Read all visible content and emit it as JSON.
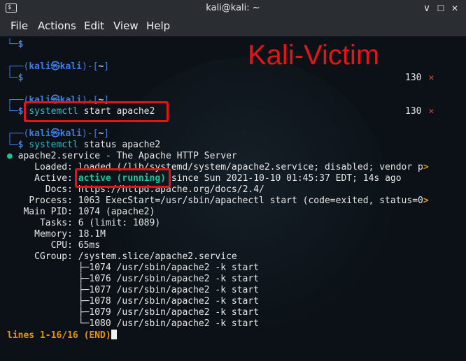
{
  "window": {
    "title": "kali@kali: ~",
    "min_symbol": "∨",
    "max_symbol": "☐",
    "close_symbol": "✕",
    "icon_text": "$_"
  },
  "menu": [
    "File",
    "Actions",
    "Edit",
    "View",
    "Help"
  ],
  "overlay_label": "Kali-Victim",
  "prompt": {
    "open": "┌──(",
    "user": "kali",
    "at": "㉿",
    "host": "kali",
    "mid": ")-[",
    "dir": "~",
    "close": "]",
    "dollar": "$",
    "corner": "└─"
  },
  "exit_codes": [
    "130",
    "130"
  ],
  "x_mark": "✕",
  "commands": {
    "cmd1": "systemctl start apache2",
    "cmd2": "systemctl status apache2",
    "cmd1_word": "systemctl",
    "cmd1_rest": " start apache2",
    "cmd2_word": "systemctl",
    "cmd2_rest": " status apache2"
  },
  "status": {
    "dot": "●",
    "header": "apache2.service - The Apache HTTP Server",
    "loaded_label": "Loaded:",
    "loaded_value": "loaded (/lib/systemd/system/apache2.service; disabled; vendor p",
    "active_label": "Active:",
    "active_state": "active (running)",
    "active_since": " since Sun 2021-10-10 01:45:37 EDT; 14s ago",
    "docs_label": "Docs:",
    "docs_value": "https://httpd.apache.org/docs/2.4/",
    "process_label": "Process:",
    "process_value": "1063 ExecStart=/usr/sbin/apachectl start (code=exited, status=0",
    "mainpid_label": "Main PID:",
    "mainpid_value": "1074 (apache2)",
    "tasks_label": "Tasks:",
    "tasks_value": "6 (limit: 1089)",
    "memory_label": "Memory:",
    "memory_value": "18.1M",
    "cpu_label": "CPU:",
    "cpu_value": "65ms",
    "cgroup_label": "CGroup:",
    "cgroup_value": "/system.slice/apache2.service",
    "processes": [
      "├─1074 /usr/sbin/apache2 -k start",
      "├─1076 /usr/sbin/apache2 -k start",
      "├─1077 /usr/sbin/apache2 -k start",
      "├─1078 /usr/sbin/apache2 -k start",
      "├─1079 /usr/sbin/apache2 -k start",
      "└─1080 /usr/sbin/apache2 -k start"
    ],
    "overflow": ">"
  },
  "pager": "lines 1-16/16 (END)"
}
